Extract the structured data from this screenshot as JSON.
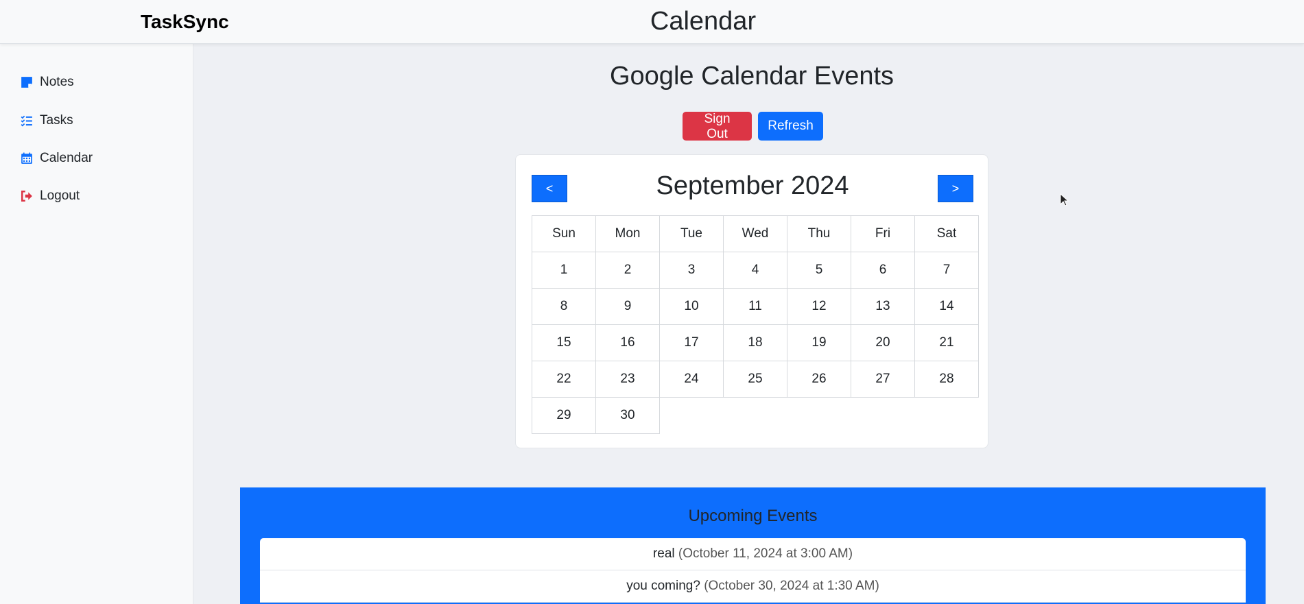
{
  "app": {
    "brand": "TaskSync",
    "page_title": "Calendar"
  },
  "sidebar": {
    "items": [
      {
        "label": "Notes",
        "icon": "sticky-note-icon",
        "color": "#0d6efd"
      },
      {
        "label": "Tasks",
        "icon": "task-list-icon",
        "color": "#0d6efd"
      },
      {
        "label": "Calendar",
        "icon": "calendar-icon",
        "color": "#0d6efd"
      },
      {
        "label": "Logout",
        "icon": "logout-icon",
        "color": "#dc3545"
      }
    ]
  },
  "main": {
    "title": "Google Calendar Events",
    "sign_out_label": "Sign Out",
    "refresh_label": "Refresh"
  },
  "calendar": {
    "month_label": "September 2024",
    "prev_label": "<",
    "next_label": ">",
    "weekdays": [
      "Sun",
      "Mon",
      "Tue",
      "Wed",
      "Thu",
      "Fri",
      "Sat"
    ],
    "weeks": [
      [
        "1",
        "2",
        "3",
        "4",
        "5",
        "6",
        "7"
      ],
      [
        "8",
        "9",
        "10",
        "11",
        "12",
        "13",
        "14"
      ],
      [
        "15",
        "16",
        "17",
        "18",
        "19",
        "20",
        "21"
      ],
      [
        "22",
        "23",
        "24",
        "25",
        "26",
        "27",
        "28"
      ],
      [
        "29",
        "30"
      ]
    ]
  },
  "events": {
    "title": "Upcoming Events",
    "items": [
      {
        "name": "real",
        "date": "(October 11, 2024 at 3:00 AM)"
      },
      {
        "name": "you coming?",
        "date": "(October 30, 2024 at 1:30 AM)"
      }
    ]
  },
  "colors": {
    "primary": "#0d6efd",
    "danger": "#dc3545"
  }
}
